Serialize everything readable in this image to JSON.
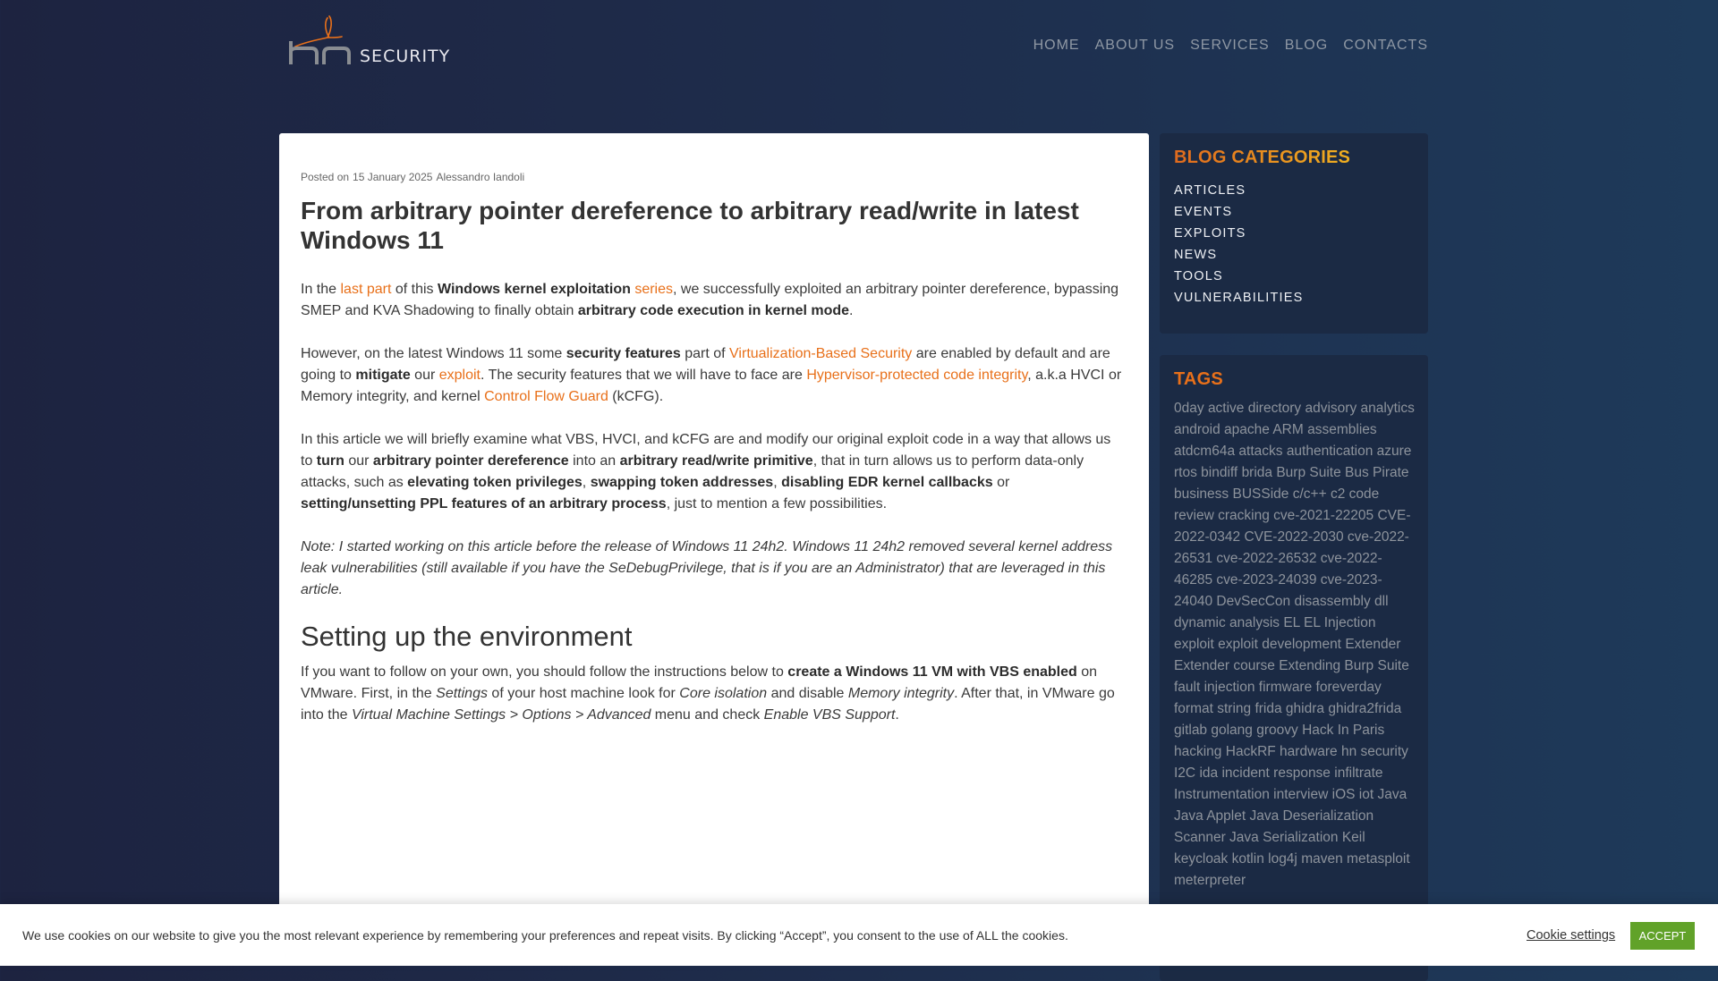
{
  "logo": {
    "mark": "hn",
    "word": "SECURITY",
    "accent_color": "#e8701a"
  },
  "nav": {
    "items": [
      {
        "label": "HOME"
      },
      {
        "label": "ABOUT US"
      },
      {
        "label": "SERVICES"
      },
      {
        "label": "BLOG"
      },
      {
        "label": "CONTACTS"
      }
    ]
  },
  "article": {
    "meta": {
      "prefix": "Posted on",
      "date": "15 January 2025",
      "author": "Alessandro Iandoli"
    },
    "title": "From arbitrary pointer dereference to arbitrary read/write in latest Windows 11",
    "p1": {
      "t1": "In the ",
      "link1": "last part",
      "t2": " of this ",
      "b1": "Windows kernel exploitation",
      "t3": " ",
      "link2": "series",
      "t4": ", we successfully exploited an arbitrary pointer dereference, bypassing SMEP and KVA Shadowing to finally obtain ",
      "b2": "arbitrary code execution in kernel mode",
      "t5": "."
    },
    "p2": {
      "t1": "However, on the latest Windows 11 some ",
      "b1": "security features",
      "t2": " part of ",
      "link1": "Virtualization-Based Security",
      "t3": " are enabled by default and are going to ",
      "b2": "mitigate",
      "t4": " our ",
      "link2": "exploit",
      "t5": ". The security features that we will have to face are ",
      "link3": "Hypervisor-protected code integrity",
      "t6": ", a.k.a HVCI or Memory integrity, and kernel ",
      "link4": "Control Flow Guard",
      "t7": " (kCFG)."
    },
    "p3": {
      "t1": "In this article we will briefly examine what VBS, HVCI, and kCFG are and modify our original exploit code in a way that allows us to ",
      "b1": "turn",
      "t2": " our ",
      "b2": "arbitrary pointer dereference",
      "t3": " into an ",
      "b3": "arbitrary read/write primitive",
      "t4": ", that in turn allows us to perform data-only attacks, such as ",
      "b4": "elevating token privileges",
      "t5": ", ",
      "b5": "swapping token addresses",
      "t6": ", ",
      "b6": "disabling EDR kernel callbacks",
      "t7": " or ",
      "b7": "setting/unsetting PPL features of an arbitrary process",
      "t8": ", just to mention a few possibilities."
    },
    "note": "Note: I started working on this article before the release of Windows 11 24h2. Windows 11 24h2 removed several kernel address leak vulnerabilities (still available if you have the SeDebugPrivilege, that is if you are an Administrator) that are leveraged in this article.",
    "section_heading": "Setting up the environment",
    "p4": {
      "t1": "If you want to follow on your own, you should follow the instructions below to ",
      "b1": "create a Windows 11 VM with VBS enabled",
      "t2": " on VMware. First, in the ",
      "i1": "Settings",
      "t3": " of your host machine look for ",
      "i2": "Core isolation",
      "t4": " and disable ",
      "i3": "Memory integrity",
      "t5": ". After that, in VMware go into the ",
      "i4": "Virtual Machine Settings > Options > Advanced",
      "t6": " menu and check ",
      "i5": "Enable VBS Support",
      "t7": "."
    }
  },
  "sidebar": {
    "categories_title": "BLOG CATEGORIES",
    "categories": [
      "ARTICLES",
      "EVENTS",
      "EXPLOITS",
      "NEWS",
      "TOOLS",
      "VULNERABILITIES"
    ],
    "tags_title": "TAGS",
    "tags": [
      "0day",
      "active directory",
      "advisory",
      "analytics",
      "android",
      "apache",
      "ARM",
      "assemblies",
      "atdcm64a",
      "attacks",
      "authentication",
      "azure rtos",
      "bindiff",
      "brida",
      "Burp Suite",
      "Bus Pirate",
      "business",
      "BUSSide",
      "c/c++",
      "c2",
      "code review",
      "cracking",
      "cve-2021-22205",
      "CVE-2022-0342",
      "CVE-2022-2030",
      "cve-2022-26531",
      "cve-2022-26532",
      "cve-2022-46285",
      "cve-2023-24039",
      "cve-2023-24040",
      "DevSecCon",
      "disassembly",
      "dll",
      "dynamic analysis",
      "EL",
      "EL Injection",
      "exploit",
      "exploit development",
      "Extender",
      "Extender course",
      "Extending Burp Suite",
      "fault injection",
      "firmware",
      "foreverday",
      "format string",
      "frida",
      "ghidra",
      "ghidra2frida",
      "gitlab",
      "golang",
      "groovy",
      "Hack In Paris",
      "hacking",
      "HackRF",
      "hardware",
      "hn security",
      "I2C",
      "ida",
      "incident response",
      "infiltrate",
      "Instrumentation",
      "interview",
      "iOS",
      "iot",
      "Java",
      "Java Applet",
      "Java Deserialization Scanner",
      "Java Serialization",
      "Keil",
      "keycloak",
      "kotlin",
      "log4j",
      "maven",
      "metasploit",
      "meterpreter"
    ]
  },
  "cookie": {
    "message": "We use cookies on our website to give you the most relevant experience by remembering your preferences and repeat visits. By clicking “Accept”, you consent to the use of ALL the cookies.",
    "settings_label": "Cookie settings",
    "accept_label": "ACCEPT",
    "accept_color": "#61a229"
  }
}
